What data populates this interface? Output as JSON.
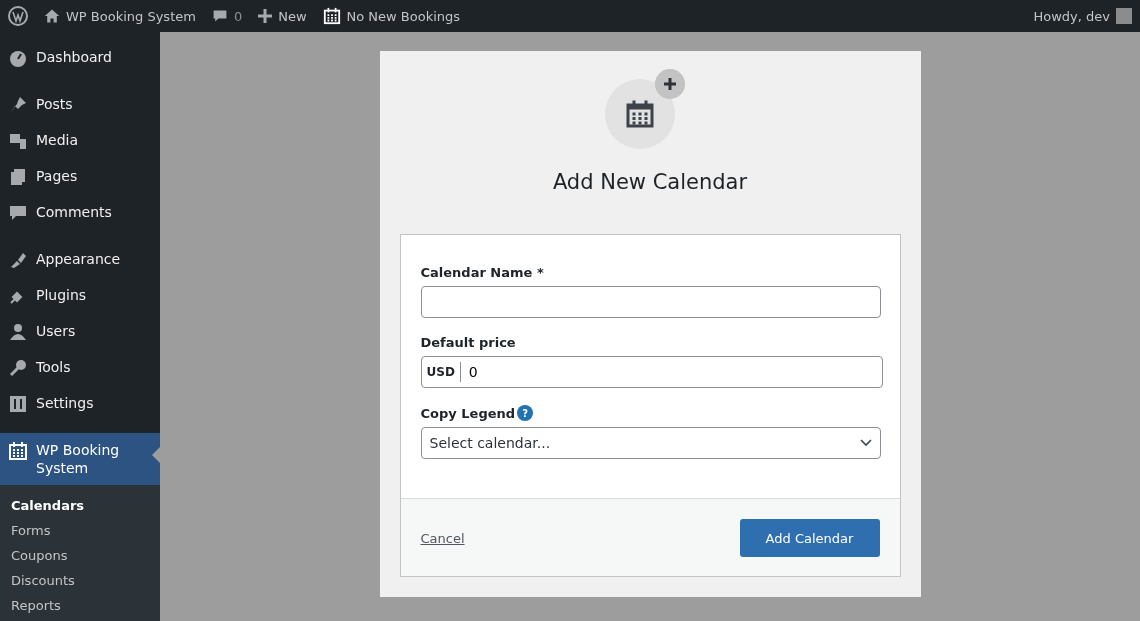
{
  "admin_bar": {
    "site_name": "WP Booking System",
    "comments_count": "0",
    "new_label": "New",
    "bookings_label": "No New Bookings",
    "greeting": "Howdy, dev"
  },
  "sidebar": {
    "groups": [
      {
        "items": [
          {
            "label": "Dashboard",
            "selected": false
          }
        ]
      },
      {
        "items": [
          {
            "label": "Posts",
            "selected": false
          },
          {
            "label": "Media",
            "selected": false
          },
          {
            "label": "Pages",
            "selected": false
          },
          {
            "label": "Comments",
            "selected": false
          }
        ]
      },
      {
        "items": [
          {
            "label": "Appearance",
            "selected": false
          },
          {
            "label": "Plugins",
            "selected": false
          },
          {
            "label": "Users",
            "selected": false
          },
          {
            "label": "Tools",
            "selected": false
          },
          {
            "label": "Settings",
            "selected": false
          }
        ]
      },
      {
        "items": [
          {
            "label": "WP Booking System",
            "selected": true
          }
        ]
      }
    ],
    "submenu": [
      {
        "label": "Calendars",
        "selected": true
      },
      {
        "label": "Forms",
        "selected": false
      },
      {
        "label": "Coupons",
        "selected": false
      },
      {
        "label": "Discounts",
        "selected": false
      },
      {
        "label": "Reports",
        "selected": false
      }
    ]
  },
  "modal": {
    "title": "Add New Calendar",
    "fields": [
      {
        "kind": "text",
        "label": "Calendar Name *"
      },
      {
        "kind": "price",
        "label": "Default price",
        "prefix": "USD",
        "value": "0"
      },
      {
        "kind": "select",
        "label": "Copy Legend",
        "help": "?",
        "value": "Select calendar..."
      }
    ],
    "cancel": "Cancel",
    "submit": "Add Calendar"
  }
}
